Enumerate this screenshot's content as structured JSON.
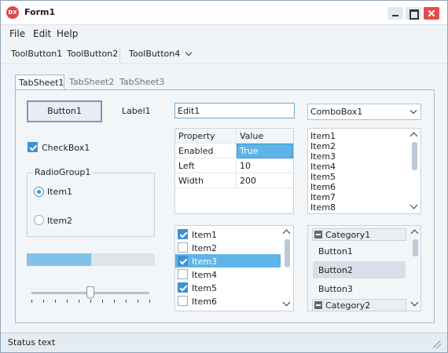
{
  "window": {
    "title": "Form1",
    "app_icon_text": "DX"
  },
  "menu": [
    "File",
    "Edit",
    "Help"
  ],
  "toolbar": {
    "buttons": [
      "ToolButton1",
      "ToolButton2"
    ],
    "dropdown_button": "ToolButton4"
  },
  "tabs": [
    "TabSheet1",
    "TabSheet2",
    "TabSheet3"
  ],
  "button1": "Button1",
  "label1": "Label1",
  "edit1": "Edit1",
  "combobox": {
    "value": "ComboBox1"
  },
  "checkbox1": {
    "label": "CheckBox1",
    "checked": true
  },
  "radiogroup": {
    "title": "RadioGroup1",
    "items": [
      {
        "label": "Item1",
        "selected": true
      },
      {
        "label": "Item2",
        "selected": false
      }
    ]
  },
  "progress": {
    "fraction": 0.5
  },
  "trackbar": {
    "position": 5,
    "min": 0,
    "max": 10
  },
  "grid": {
    "headers": [
      "Property",
      "Value"
    ],
    "rows": [
      [
        "Enabled",
        "True"
      ],
      [
        "Left",
        "10"
      ],
      [
        "Width",
        "200"
      ]
    ]
  },
  "listbox": {
    "items": [
      "Item1",
      "Item2",
      "Item3",
      "Item4",
      "Item5",
      "Item6",
      "Item7",
      "Item8"
    ]
  },
  "checklist": {
    "items": [
      {
        "label": "Item1",
        "checked": true
      },
      {
        "label": "Item2",
        "checked": false
      },
      {
        "label": "Item3",
        "checked": true
      },
      {
        "label": "Item4",
        "checked": false
      },
      {
        "label": "Item5",
        "checked": true
      },
      {
        "label": "Item6",
        "checked": false
      }
    ],
    "selected_index": 2
  },
  "navbar": {
    "category1": "Category1",
    "items": [
      "Button1",
      "Button2",
      "Button3"
    ],
    "category2": "Category2"
  },
  "statusbar": {
    "text": "Status text"
  },
  "colors": {
    "accent": "#3f92d2",
    "selection": "#5eb4e6",
    "close": "#e24c4c"
  }
}
